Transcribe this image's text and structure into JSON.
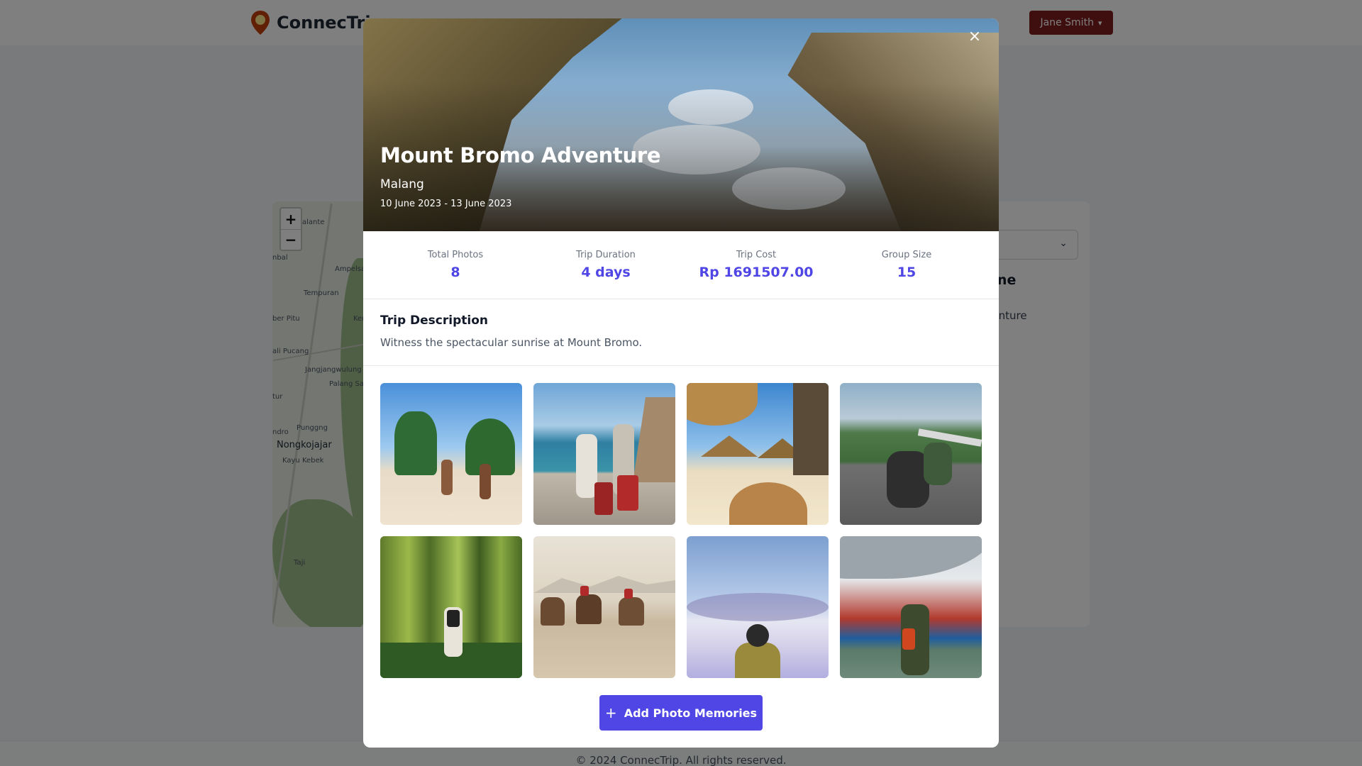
{
  "header": {
    "brand_name": "ConnecTrip",
    "user_name": "Jane Smith"
  },
  "map": {
    "zoom_in": "+",
    "zoom_out": "−",
    "labels": [
      "alante",
      "nbal",
      "Ampelsa",
      "Tempuran",
      "ber Pitu",
      "Ker",
      "ali Pucang",
      "Jangjangwulung",
      "Palang Sa",
      "tur",
      "ndro",
      "Punggng",
      "Nongkojajar",
      "Kayu Kebek",
      "Taji"
    ]
  },
  "side_panel": {
    "heading": "eline",
    "item": "dventure"
  },
  "footer": {
    "text": "© 2024 ConnecTrip. All rights reserved."
  },
  "modal": {
    "close_icon": "×",
    "title": "Mount Bromo Adventure",
    "city": "Malang",
    "dates": "10 June 2023 - 13 June 2023",
    "stats": [
      {
        "label": "Total Photos",
        "value": "8"
      },
      {
        "label": "Trip Duration",
        "value": "4 days"
      },
      {
        "label": "Trip Cost",
        "value": "Rp 1691507.00"
      },
      {
        "label": "Group Size",
        "value": "15"
      }
    ],
    "description_title": "Trip Description",
    "description_text": "Witness the spectacular sunrise at Mount Bromo.",
    "add_button": "Add Photo Memories"
  },
  "colors": {
    "accent": "#4f46e5",
    "user_menu": "#7f1d1d"
  }
}
